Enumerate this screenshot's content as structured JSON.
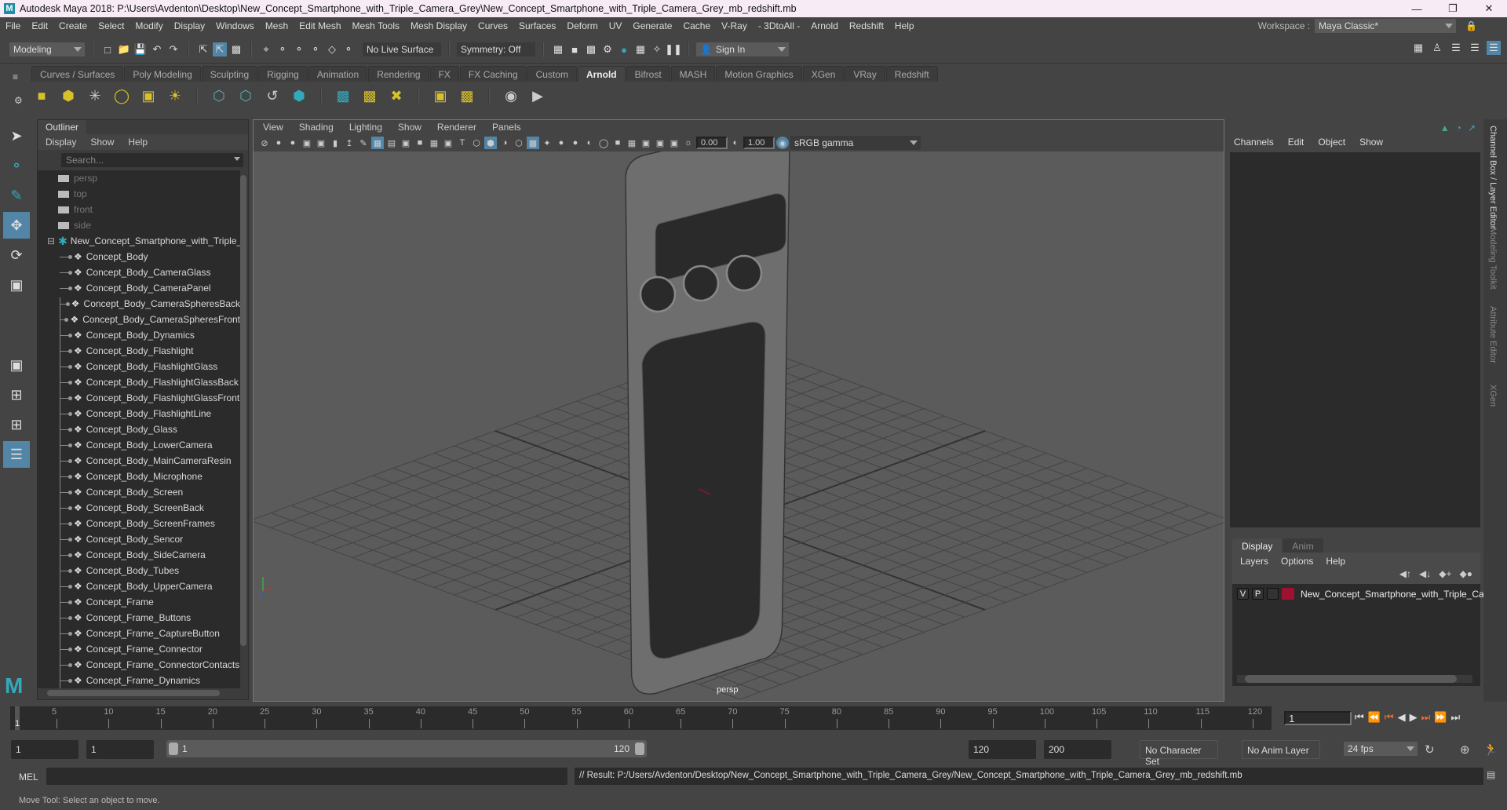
{
  "titlebar": {
    "app_icon": "maya-logo-icon",
    "title": "Autodesk Maya 2018: P:\\Users\\Avdenton\\Desktop\\New_Concept_Smartphone_with_Triple_Camera_Grey\\New_Concept_Smartphone_with_Triple_Camera_Grey_mb_redshift.mb",
    "buttons": [
      "minimize",
      "restore",
      "close"
    ]
  },
  "menubar": {
    "items": [
      "File",
      "Edit",
      "Create",
      "Select",
      "Modify",
      "Display",
      "Windows",
      "Mesh",
      "Edit Mesh",
      "Mesh Tools",
      "Mesh Display",
      "Curves",
      "Surfaces",
      "Deform",
      "UV",
      "Generate",
      "Cache",
      "V-Ray",
      "- 3DtoAll -",
      "Arnold",
      "Redshift",
      "Help"
    ],
    "workspace_label": "Workspace :",
    "workspace_value": "Maya Classic*"
  },
  "statusline": {
    "mode": "Modeling",
    "live_surface": "No Live Surface",
    "symmetry": "Symmetry: Off",
    "sign_in": "Sign In"
  },
  "shelf": {
    "tabs": [
      "Curves / Surfaces",
      "Poly Modeling",
      "Sculpting",
      "Rigging",
      "Animation",
      "Rendering",
      "FX",
      "FX Caching",
      "Custom",
      "Arnold",
      "Bifrost",
      "MASH",
      "Motion Graphics",
      "XGen",
      "VRay",
      "Redshift"
    ],
    "active_tab": "Arnold"
  },
  "outliner": {
    "title": "Outliner",
    "menu": [
      "Display",
      "Show",
      "Help"
    ],
    "search_placeholder": "Search...",
    "cameras": [
      "persp",
      "top",
      "front",
      "side"
    ],
    "root": "New_Concept_Smartphone_with_Triple_Camera_Grey",
    "children": [
      "Concept_Body",
      "Concept_Body_CameraGlass",
      "Concept_Body_CameraPanel",
      "Concept_Body_CameraSpheresBack",
      "Concept_Body_CameraSpheresFront",
      "Concept_Body_Dynamics",
      "Concept_Body_Flashlight",
      "Concept_Body_FlashlightGlass",
      "Concept_Body_FlashlightGlassBack",
      "Concept_Body_FlashlightGlassFront",
      "Concept_Body_FlashlightLine",
      "Concept_Body_Glass",
      "Concept_Body_LowerCamera",
      "Concept_Body_MainCameraResin",
      "Concept_Body_Microphone",
      "Concept_Body_Screen",
      "Concept_Body_ScreenBack",
      "Concept_Body_ScreenFrames",
      "Concept_Body_Sencor",
      "Concept_Body_SideCamera",
      "Concept_Body_Tubes",
      "Concept_Body_UpperCamera",
      "Concept_Frame",
      "Concept_Frame_Buttons",
      "Concept_Frame_CaptureButton",
      "Concept_Frame_Connector",
      "Concept_Frame_ConnectorContacts",
      "Concept_Frame_Dynamics"
    ]
  },
  "viewport": {
    "menu": [
      "View",
      "Shading",
      "Lighting",
      "Show",
      "Renderer",
      "Panels"
    ],
    "exposure": "0.00",
    "gamma": "1.00",
    "color_space": "sRGB gamma",
    "camera_label": "persp"
  },
  "channelbox": {
    "menu": [
      "Channels",
      "Edit",
      "Object",
      "Show"
    ]
  },
  "layer_editor": {
    "tabs": [
      "Display",
      "Anim"
    ],
    "active_tab": "Display",
    "menu": [
      "Layers",
      "Options",
      "Help"
    ],
    "layers": [
      {
        "v": "V",
        "p": "P",
        "color": "#a01030",
        "name": "New_Concept_Smartphone_with_Triple_Camera_Grey"
      }
    ]
  },
  "side_tabs": [
    "Channel Box / Layer Editor",
    "Modeling Toolkit",
    "Attribute Editor",
    "XGen"
  ],
  "timeline": {
    "ticks": [
      5,
      10,
      15,
      20,
      25,
      30,
      35,
      40,
      45,
      50,
      55,
      60,
      65,
      70,
      75,
      80,
      85,
      90,
      95,
      100,
      105,
      110,
      115,
      120
    ],
    "start_marker": "1",
    "current_frame": "1"
  },
  "range": {
    "start": "1",
    "playback_start": "1",
    "slider_start": "1",
    "slider_end": "120",
    "playback_end": "120",
    "end": "200",
    "character_set": "No Character Set",
    "anim_layer": "No Anim Layer",
    "fps": "24 fps"
  },
  "command": {
    "lang": "MEL",
    "result": "// Result: P:/Users/Avdenton/Desktop/New_Concept_Smartphone_with_Triple_Camera_Grey/New_Concept_Smartphone_with_Triple_Camera_Grey_mb_redshift.mb"
  },
  "help_line": "Move Tool: Select an object to move.",
  "colors": {
    "accent": "#5285a6",
    "layer_color": "#a01030",
    "viewport_bg": "#5b5b5b"
  }
}
